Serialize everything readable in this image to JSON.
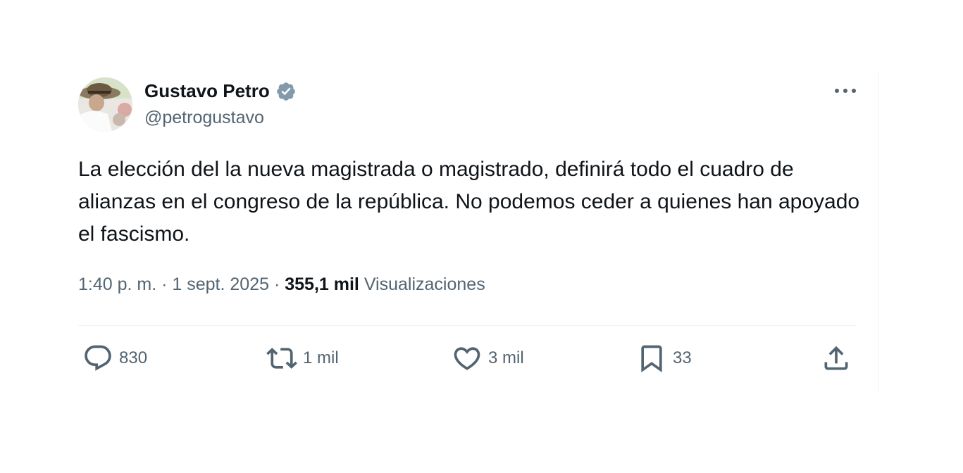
{
  "author": {
    "name": "Gustavo Petro",
    "handle": "@petrogustavo",
    "verified_color": "#829aab"
  },
  "tweet": {
    "text": "La elección del la nueva magistrada o magistrado, definirá todo el cuadro de alianzas en el congreso de la república. No podemos ceder a quienes han apoyado el fascismo.",
    "time": "1:40 p. m.",
    "date": "1 sept. 2025",
    "views_count": "355,1 mil",
    "views_label": "Visualizaciones",
    "separator": " · "
  },
  "actions": {
    "replies": "830",
    "retweets": "1 mil",
    "likes": "3 mil",
    "bookmarks": "33"
  },
  "icons": {
    "reply": "speech-bubble-icon",
    "retweet": "retweet-arrows-icon",
    "like": "heart-icon",
    "bookmark": "bookmark-icon",
    "share": "share-upload-icon",
    "more": "more-dots-icon",
    "verified": "verified-badge-icon"
  },
  "colors": {
    "text_primary": "#0f1419",
    "text_secondary": "#536471",
    "divider": "#eff3f4"
  }
}
